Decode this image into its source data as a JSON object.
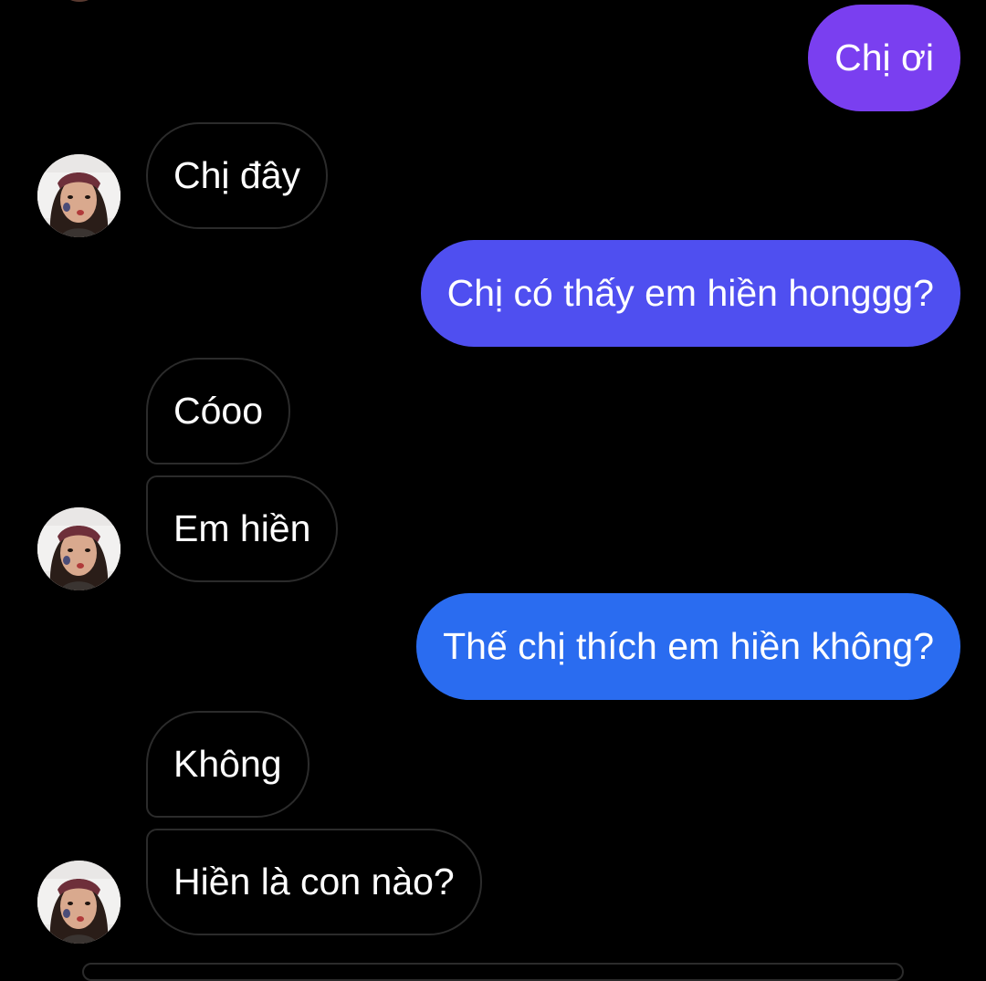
{
  "colors": {
    "background": "#000000",
    "incoming_bubble_border": "#2b2b2b",
    "outgoing_gradient_top": "#7a3ff0",
    "outgoing_gradient_mid": "#4f4ff0",
    "outgoing_gradient_bottom": "#2a6cf0",
    "text": "#ffffff"
  },
  "messages": [
    {
      "sender": "me",
      "text": "Chị ơi"
    },
    {
      "sender": "contact",
      "text": "Chị đây"
    },
    {
      "sender": "me",
      "text": "Chị có thấy em hiền honggg?"
    },
    {
      "sender": "contact",
      "text": "Cóoo"
    },
    {
      "sender": "contact",
      "text": "Em hiền"
    },
    {
      "sender": "me",
      "text": "Thế chị thích em hiền không?"
    },
    {
      "sender": "contact",
      "text": "Không"
    },
    {
      "sender": "contact",
      "text": "Hiền là con nào?"
    }
  ],
  "icons": {
    "contact_avatar": "avatar-photo-icon"
  }
}
